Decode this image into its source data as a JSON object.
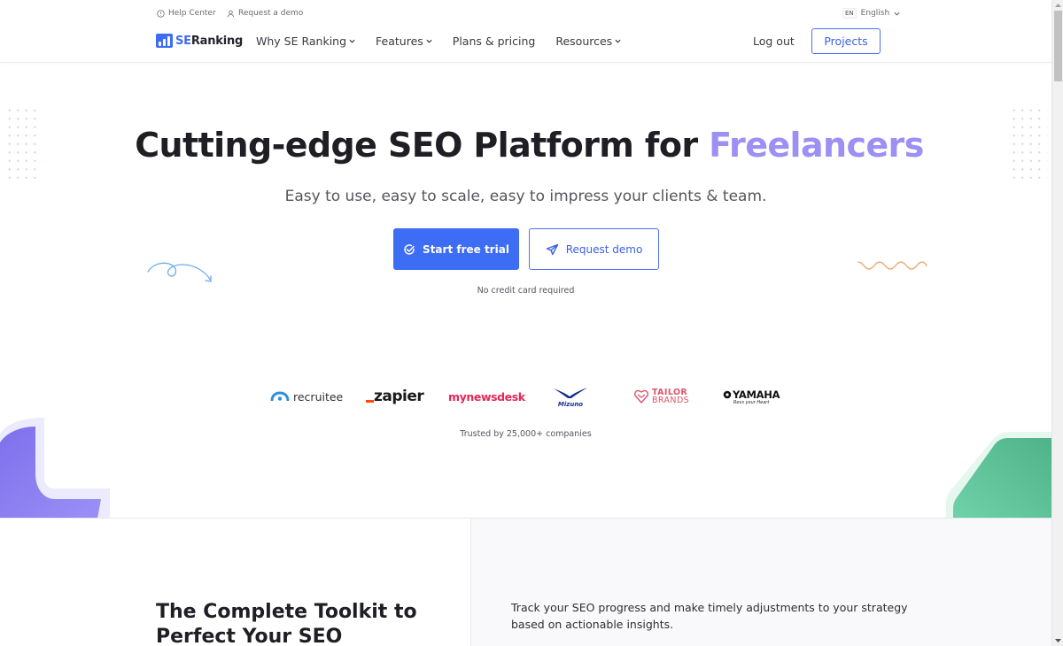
{
  "topbar": {
    "help_center": "Help Center",
    "request_demo": "Request a demo",
    "language_code": "EN",
    "language": "English"
  },
  "header": {
    "logo_se": "SE",
    "logo_ranking": "Ranking",
    "nav": [
      {
        "label": "Why SE Ranking",
        "has_dropdown": true
      },
      {
        "label": "Features",
        "has_dropdown": true
      },
      {
        "label": "Plans & pricing",
        "has_dropdown": false
      },
      {
        "label": "Resources",
        "has_dropdown": true
      }
    ],
    "logout": "Log out",
    "projects": "Projects"
  },
  "hero": {
    "title_main": "Cutting-edge SEO Platform for ",
    "title_accent": "Freelancers",
    "subtitle": "Easy to use, easy to scale, easy to impress your clients & team.",
    "primary_cta": "Start free trial",
    "secondary_cta": "Request demo",
    "note": "No credit card required"
  },
  "brands": {
    "items": [
      "recruitee",
      "zapier",
      "mynewsdesk",
      "Mizuno",
      "TAILOR BRANDS",
      "YAMAHA"
    ],
    "trusted": "Trusted by 25,000+ companies"
  },
  "section2": {
    "title": "The Complete Toolkit to Perfect Your SEO",
    "description": "Track your SEO progress and make timely adjustments to your strategy based on actionable insights."
  },
  "colors": {
    "brand_blue": "#3d6cf5",
    "accent_purple": "#9d90f4",
    "decor_purple": "#8a7df0",
    "decor_green": "#5ec59a",
    "decor_orange": "#f0a060",
    "decor_blue": "#6aaee8"
  }
}
